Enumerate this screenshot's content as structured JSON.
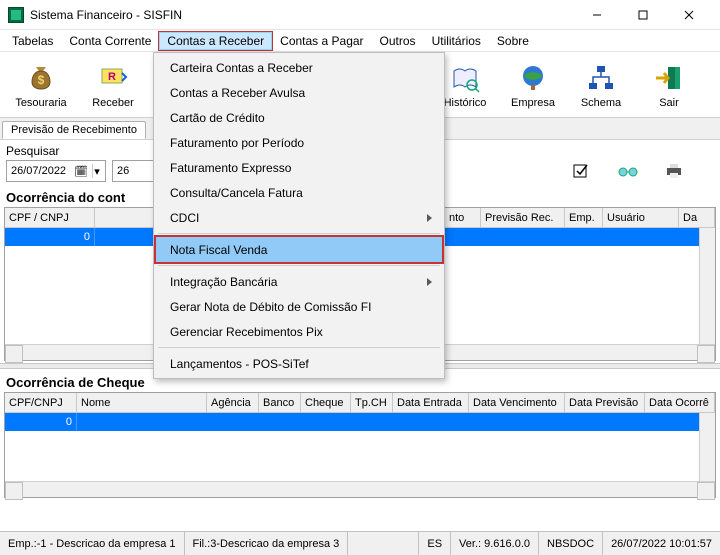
{
  "window": {
    "title": "Sistema Financeiro - SISFIN"
  },
  "menubar": {
    "items": [
      "Tabelas",
      "Conta Corrente",
      "Contas a Receber",
      "Contas a Pagar",
      "Outros",
      "Utilitários",
      "Sobre"
    ],
    "active_index": 2
  },
  "toolbar": {
    "items": [
      {
        "label": "Tesouraria",
        "icon": "money-bag-icon"
      },
      {
        "label": "Receber",
        "icon": "receive-icon"
      },
      {
        "label": "",
        "icon": ""
      },
      {
        "label": "",
        "icon": ""
      },
      {
        "label": "",
        "icon": ""
      },
      {
        "label": "",
        "icon": ""
      },
      {
        "label": "Histórico",
        "icon": "book-icon"
      },
      {
        "label": "Empresa",
        "icon": "globe-icon"
      },
      {
        "label": "Schema",
        "icon": "hierarchy-icon"
      },
      {
        "label": "Sair",
        "icon": "exit-icon"
      }
    ]
  },
  "tab": {
    "label": "Previsão de Recebimento"
  },
  "search": {
    "label": "Pesquisar",
    "date1": "26/07/2022",
    "date2": "26"
  },
  "section1": {
    "heading": "Ocorrência do cont"
  },
  "grid1": {
    "columns": [
      "CPF / CNPJ",
      "",
      "",
      "nto",
      "Previsão Rec.",
      "Emp.",
      "Usuário",
      "Da"
    ],
    "row0_cell0": "0"
  },
  "section2": {
    "heading": "Ocorrência de Cheque"
  },
  "grid2": {
    "columns": [
      "CPF/CNPJ",
      "Nome",
      "Agência",
      "Banco",
      "Cheque",
      "Tp.CH",
      "Data Entrada",
      "Data Vencimento",
      "Data Previsão",
      "Data Ocorrê"
    ],
    "row0_cell0": "0"
  },
  "dropdown": {
    "items": [
      {
        "label": "Carteira Contas a Receber"
      },
      {
        "label": "Contas a Receber Avulsa"
      },
      {
        "label": "Cartão de Crédito"
      },
      {
        "label": "Faturamento por Período"
      },
      {
        "label": "Faturamento Expresso"
      },
      {
        "label": "Consulta/Cancela Fatura"
      },
      {
        "label": "CDCI",
        "sub": true
      },
      {
        "sep": true
      },
      {
        "label": "Nota Fiscal Venda",
        "highlight": true
      },
      {
        "sep": true
      },
      {
        "label": "Integração Bancária",
        "sub": true
      },
      {
        "label": "Gerar Nota de Débito de Comissão FI"
      },
      {
        "label": "Gerenciar Recebimentos Pix"
      },
      {
        "sep": true
      },
      {
        "label": "Lançamentos - POS-SiTef"
      }
    ]
  },
  "statusbar": {
    "emp": "Emp.:-1 - Descricao da empresa 1",
    "fil": "Fil.:3-Descricao da empresa 3",
    "es": "ES",
    "ver": "Ver.: 9.616.0.0",
    "db": "NBSDOC",
    "ts": "26/07/2022 10:01:57"
  }
}
